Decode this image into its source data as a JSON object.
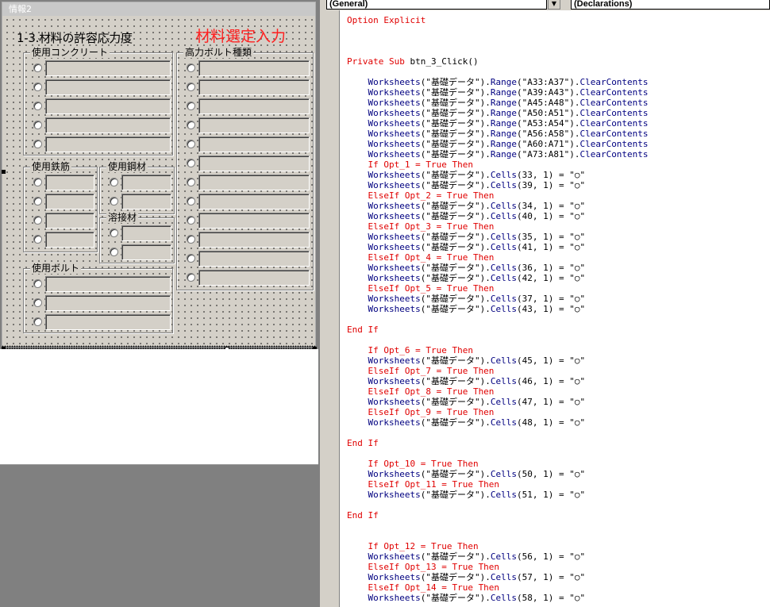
{
  "form": {
    "title": "情報2",
    "caption": "1-3.材料の許容応力度",
    "red_title": "材料選定入力",
    "frames": {
      "concrete": "使用コンクリート",
      "hibolt": "高力ボルト種類",
      "rebar": "使用鉄筋",
      "steel": "使用鋼材",
      "weld": "溶接材",
      "bolt": "使用ボルト"
    }
  },
  "editor": {
    "object_combo": "(General)",
    "proc_combo": "(Declarations)",
    "combo_arrow": "▼"
  },
  "code": [
    [
      {
        "t": "Option Explicit",
        "c": "kw"
      }
    ],
    [],
    [],
    [],
    [
      {
        "t": "Private Sub ",
        "c": "kw"
      },
      {
        "t": "btn_3_Click()",
        "c": "tx"
      }
    ],
    [],
    [
      {
        "t": "    Worksheets",
        "c": "bl"
      },
      {
        "t": "(\"基礎データ\").",
        "c": "tx"
      },
      {
        "t": "Range",
        "c": "bl"
      },
      {
        "t": "(\"A33:A37\").",
        "c": "tx"
      },
      {
        "t": "ClearContents",
        "c": "bl"
      }
    ],
    [
      {
        "t": "    Worksheets",
        "c": "bl"
      },
      {
        "t": "(\"基礎データ\").",
        "c": "tx"
      },
      {
        "t": "Range",
        "c": "bl"
      },
      {
        "t": "(\"A39:A43\").",
        "c": "tx"
      },
      {
        "t": "ClearContents",
        "c": "bl"
      }
    ],
    [
      {
        "t": "    Worksheets",
        "c": "bl"
      },
      {
        "t": "(\"基礎データ\").",
        "c": "tx"
      },
      {
        "t": "Range",
        "c": "bl"
      },
      {
        "t": "(\"A45:A48\").",
        "c": "tx"
      },
      {
        "t": "ClearContents",
        "c": "bl"
      }
    ],
    [
      {
        "t": "    Worksheets",
        "c": "bl"
      },
      {
        "t": "(\"基礎データ\").",
        "c": "tx"
      },
      {
        "t": "Range",
        "c": "bl"
      },
      {
        "t": "(\"A50:A51\").",
        "c": "tx"
      },
      {
        "t": "ClearContents",
        "c": "bl"
      }
    ],
    [
      {
        "t": "    Worksheets",
        "c": "bl"
      },
      {
        "t": "(\"基礎データ\").",
        "c": "tx"
      },
      {
        "t": "Range",
        "c": "bl"
      },
      {
        "t": "(\"A53:A54\").",
        "c": "tx"
      },
      {
        "t": "ClearContents",
        "c": "bl"
      }
    ],
    [
      {
        "t": "    Worksheets",
        "c": "bl"
      },
      {
        "t": "(\"基礎データ\").",
        "c": "tx"
      },
      {
        "t": "Range",
        "c": "bl"
      },
      {
        "t": "(\"A56:A58\").",
        "c": "tx"
      },
      {
        "t": "ClearContents",
        "c": "bl"
      }
    ],
    [
      {
        "t": "    Worksheets",
        "c": "bl"
      },
      {
        "t": "(\"基礎データ\").",
        "c": "tx"
      },
      {
        "t": "Range",
        "c": "bl"
      },
      {
        "t": "(\"A60:A71\").",
        "c": "tx"
      },
      {
        "t": "ClearContents",
        "c": "bl"
      }
    ],
    [
      {
        "t": "    Worksheets",
        "c": "bl"
      },
      {
        "t": "(\"基礎データ\").",
        "c": "tx"
      },
      {
        "t": "Range",
        "c": "bl"
      },
      {
        "t": "(\"A73:A81\").",
        "c": "tx"
      },
      {
        "t": "ClearContents",
        "c": "bl"
      }
    ],
    [
      {
        "t": "    If ",
        "c": "kw"
      },
      {
        "t": "Opt_1 = ",
        "c": "kw"
      },
      {
        "t": "True Then",
        "c": "kw"
      }
    ],
    [
      {
        "t": "    Worksheets",
        "c": "bl"
      },
      {
        "t": "(\"基礎データ\").",
        "c": "tx"
      },
      {
        "t": "Cells",
        "c": "bl"
      },
      {
        "t": "(33, 1) = \"○\"",
        "c": "tx"
      }
    ],
    [
      {
        "t": "    Worksheets",
        "c": "bl"
      },
      {
        "t": "(\"基礎データ\").",
        "c": "tx"
      },
      {
        "t": "Cells",
        "c": "bl"
      },
      {
        "t": "(39, 1) = \"○\"",
        "c": "tx"
      }
    ],
    [
      {
        "t": "    ElseIf Opt_2 = True Then",
        "c": "kw"
      }
    ],
    [
      {
        "t": "    Worksheets",
        "c": "bl"
      },
      {
        "t": "(\"基礎データ\").",
        "c": "tx"
      },
      {
        "t": "Cells",
        "c": "bl"
      },
      {
        "t": "(34, 1) = \"○\"",
        "c": "tx"
      }
    ],
    [
      {
        "t": "    Worksheets",
        "c": "bl"
      },
      {
        "t": "(\"基礎データ\").",
        "c": "tx"
      },
      {
        "t": "Cells",
        "c": "bl"
      },
      {
        "t": "(40, 1) = \"○\"",
        "c": "tx"
      }
    ],
    [
      {
        "t": "    ElseIf Opt_3 = True Then",
        "c": "kw"
      }
    ],
    [
      {
        "t": "    Worksheets",
        "c": "bl"
      },
      {
        "t": "(\"基礎データ\").",
        "c": "tx"
      },
      {
        "t": "Cells",
        "c": "bl"
      },
      {
        "t": "(35, 1) = \"○\"",
        "c": "tx"
      }
    ],
    [
      {
        "t": "    Worksheets",
        "c": "bl"
      },
      {
        "t": "(\"基礎データ\").",
        "c": "tx"
      },
      {
        "t": "Cells",
        "c": "bl"
      },
      {
        "t": "(41, 1) = \"○\"",
        "c": "tx"
      }
    ],
    [
      {
        "t": "    ElseIf Opt_4 = True Then",
        "c": "kw"
      }
    ],
    [
      {
        "t": "    Worksheets",
        "c": "bl"
      },
      {
        "t": "(\"基礎データ\").",
        "c": "tx"
      },
      {
        "t": "Cells",
        "c": "bl"
      },
      {
        "t": "(36, 1) = \"○\"",
        "c": "tx"
      }
    ],
    [
      {
        "t": "    Worksheets",
        "c": "bl"
      },
      {
        "t": "(\"基礎データ\").",
        "c": "tx"
      },
      {
        "t": "Cells",
        "c": "bl"
      },
      {
        "t": "(42, 1) = \"○\"",
        "c": "tx"
      }
    ],
    [
      {
        "t": "    ElseIf Opt_5 = True Then",
        "c": "kw"
      }
    ],
    [
      {
        "t": "    Worksheets",
        "c": "bl"
      },
      {
        "t": "(\"基礎データ\").",
        "c": "tx"
      },
      {
        "t": "Cells",
        "c": "bl"
      },
      {
        "t": "(37, 1) = \"○\"",
        "c": "tx"
      }
    ],
    [
      {
        "t": "    Worksheets",
        "c": "bl"
      },
      {
        "t": "(\"基礎データ\").",
        "c": "tx"
      },
      {
        "t": "Cells",
        "c": "bl"
      },
      {
        "t": "(43, 1) = \"○\"",
        "c": "tx"
      }
    ],
    [],
    [
      {
        "t": "End If",
        "c": "kw"
      }
    ],
    [],
    [
      {
        "t": "    If Opt_6 = True Then",
        "c": "kw"
      }
    ],
    [
      {
        "t": "    Worksheets",
        "c": "bl"
      },
      {
        "t": "(\"基礎データ\").",
        "c": "tx"
      },
      {
        "t": "Cells",
        "c": "bl"
      },
      {
        "t": "(45, 1) = \"○\"",
        "c": "tx"
      }
    ],
    [
      {
        "t": "    ElseIf Opt_7 = True Then",
        "c": "kw"
      }
    ],
    [
      {
        "t": "    Worksheets",
        "c": "bl"
      },
      {
        "t": "(\"基礎データ\").",
        "c": "tx"
      },
      {
        "t": "Cells",
        "c": "bl"
      },
      {
        "t": "(46, 1) = \"○\"",
        "c": "tx"
      }
    ],
    [
      {
        "t": "    ElseIf Opt_8 = True Then",
        "c": "kw"
      }
    ],
    [
      {
        "t": "    Worksheets",
        "c": "bl"
      },
      {
        "t": "(\"基礎データ\").",
        "c": "tx"
      },
      {
        "t": "Cells",
        "c": "bl"
      },
      {
        "t": "(47, 1) = \"○\"",
        "c": "tx"
      }
    ],
    [
      {
        "t": "    ElseIf Opt_9 = True Then",
        "c": "kw"
      }
    ],
    [
      {
        "t": "    Worksheets",
        "c": "bl"
      },
      {
        "t": "(\"基礎データ\").",
        "c": "tx"
      },
      {
        "t": "Cells",
        "c": "bl"
      },
      {
        "t": "(48, 1) = \"○\"",
        "c": "tx"
      }
    ],
    [],
    [
      {
        "t": "End If",
        "c": "kw"
      }
    ],
    [],
    [
      {
        "t": "    If Opt_10 = True Then",
        "c": "kw"
      }
    ],
    [
      {
        "t": "    Worksheets",
        "c": "bl"
      },
      {
        "t": "(\"基礎データ\").",
        "c": "tx"
      },
      {
        "t": "Cells",
        "c": "bl"
      },
      {
        "t": "(50, 1) = \"○\"",
        "c": "tx"
      }
    ],
    [
      {
        "t": "    ElseIf Opt_11 = True Then",
        "c": "kw"
      }
    ],
    [
      {
        "t": "    Worksheets",
        "c": "bl"
      },
      {
        "t": "(\"基礎データ\").",
        "c": "tx"
      },
      {
        "t": "Cells",
        "c": "bl"
      },
      {
        "t": "(51, 1) = \"○\"",
        "c": "tx"
      }
    ],
    [],
    [
      {
        "t": "End If",
        "c": "kw"
      }
    ],
    [],
    [],
    [
      {
        "t": "    If Opt_12 = True Then",
        "c": "kw"
      }
    ],
    [
      {
        "t": "    Worksheets",
        "c": "bl"
      },
      {
        "t": "(\"基礎データ\").",
        "c": "tx"
      },
      {
        "t": "Cells",
        "c": "bl"
      },
      {
        "t": "(56, 1) = \"○\"",
        "c": "tx"
      }
    ],
    [
      {
        "t": "    ElseIf Opt_13 = True Then",
        "c": "kw"
      }
    ],
    [
      {
        "t": "    Worksheets",
        "c": "bl"
      },
      {
        "t": "(\"基礎データ\").",
        "c": "tx"
      },
      {
        "t": "Cells",
        "c": "bl"
      },
      {
        "t": "(57, 1) = \"○\"",
        "c": "tx"
      }
    ],
    [
      {
        "t": "    ElseIf Opt_14 = True Then",
        "c": "kw"
      }
    ],
    [
      {
        "t": "    Worksheets",
        "c": "bl"
      },
      {
        "t": "(\"基礎データ\").",
        "c": "tx"
      },
      {
        "t": "Cells",
        "c": "bl"
      },
      {
        "t": "(58, 1) = \"○\"",
        "c": "tx"
      }
    ]
  ]
}
